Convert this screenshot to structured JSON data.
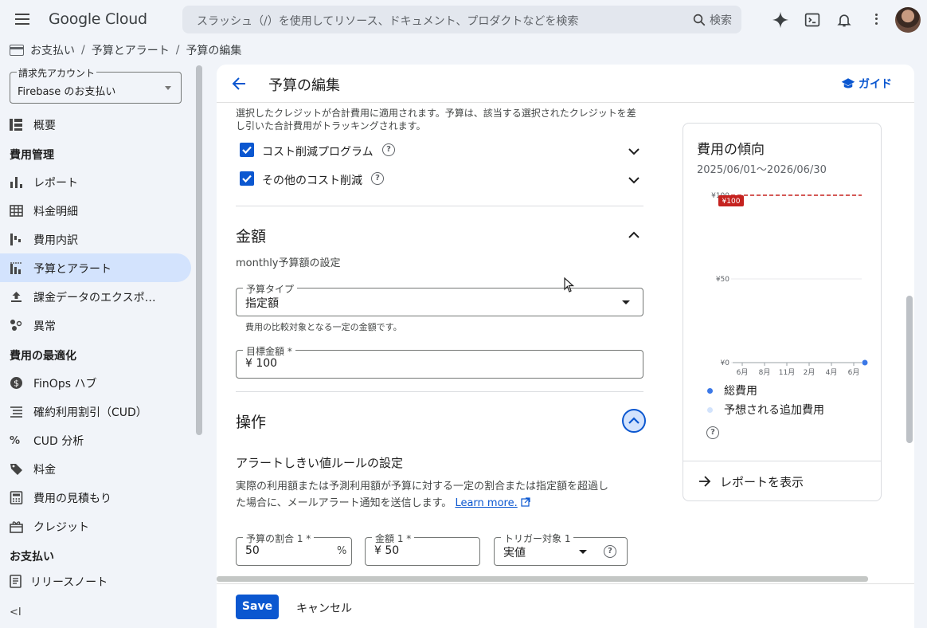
{
  "topbar": {
    "logo": "Google Cloud",
    "search_placeholder": "スラッシュ（/）を使用してリソース、ドキュメント、プロダクトなどを検索",
    "search_button": "検索"
  },
  "breadcrumb": [
    "お支払い",
    "予算とアラート",
    "予算の編集"
  ],
  "sidebar": {
    "account_label": "請求先アカウント",
    "account_value": "Firebase のお支払い",
    "overview": "概要",
    "section_cost_mgmt": "費用管理",
    "items_cost": [
      {
        "label": "レポート",
        "icon": "bar-chart-icon"
      },
      {
        "label": "料金明細",
        "icon": "table-icon"
      },
      {
        "label": "費用内訳",
        "icon": "waterfall-icon"
      },
      {
        "label": "予算とアラート",
        "icon": "budget-chart-icon",
        "selected": true
      },
      {
        "label": "課金データのエクスポ…",
        "icon": "upload-icon"
      },
      {
        "label": "異常",
        "icon": "anomaly-icon"
      }
    ],
    "section_optimize": "費用の最適化",
    "items_optimize": [
      {
        "label": "FinOps ハブ",
        "icon": "dollar-circle-icon"
      },
      {
        "label": "確約利用割引（CUD）",
        "icon": "list-icon"
      },
      {
        "label": "CUD 分析",
        "icon": "percent-icon"
      },
      {
        "label": "料金",
        "icon": "tag-icon"
      },
      {
        "label": "費用の見積もり",
        "icon": "calculator-icon"
      },
      {
        "label": "クレジット",
        "icon": "gift-icon"
      }
    ],
    "section_payment": "お支払い",
    "release_notes": "リリースノート"
  },
  "main": {
    "title": "予算の編集",
    "guide": "ガイド",
    "credits_desc": "選択したクレジットが合計費用に適用されます。予算は、該当する選択されたクレジットを差し引いた合計費用がトラッキングされます。",
    "checkbox1": "コスト削減プログラム",
    "checkbox2": "その他のコスト削減",
    "amount_heading": "金額",
    "amount_sub": "monthly予算額の設定",
    "budget_type_label": "予算タイプ",
    "budget_type_value": "指定額",
    "budget_type_help": "費用の比較対象となる一定の金額です。",
    "target_label": "目標金額 *",
    "target_value": "¥ 100",
    "actions_heading": "操作",
    "alert_heading": "アラートしきい値ルールの設定",
    "alert_desc1": "実際の利用額または予測利用額が予算に対する一定の割合または指定額を超過し",
    "alert_desc2": "た場合に、メールアラート通知を送信します。",
    "learn_more": "Learn more.",
    "pct_label": "予算の割合 1 *",
    "pct_value": "50",
    "pct_unit": "%",
    "amt_label": "金額 1 *",
    "amt_value": "¥ 50",
    "trigger_label": "トリガー対象 1",
    "trigger_value": "実値"
  },
  "card": {
    "title": "費用の傾向",
    "range": "2025/06/01〜2026/06/30",
    "report_link": "レポートを表示",
    "legend": [
      {
        "label": "総費用",
        "color": "#3b78e7"
      },
      {
        "label": "予想される追加費用",
        "color": "#d2e3fc"
      }
    ]
  },
  "chart_data": {
    "type": "line",
    "categories": [
      "6月",
      "8月",
      "11月",
      "2月",
      "4月",
      "6月"
    ],
    "yticks": [
      "¥100",
      "¥50",
      "¥0"
    ],
    "ylim": [
      0,
      100
    ],
    "budget_line": 100,
    "budget_badge": "¥100",
    "series": [
      {
        "name": "総費用",
        "values": [
          0,
          0,
          0,
          0,
          0,
          0
        ]
      }
    ]
  },
  "footer": {
    "save": "Save",
    "cancel": "キャンセル"
  },
  "colors": {
    "accent": "#0b57d0",
    "budget_line": "#c5221f",
    "selected_nav": "#d3e3fd"
  }
}
